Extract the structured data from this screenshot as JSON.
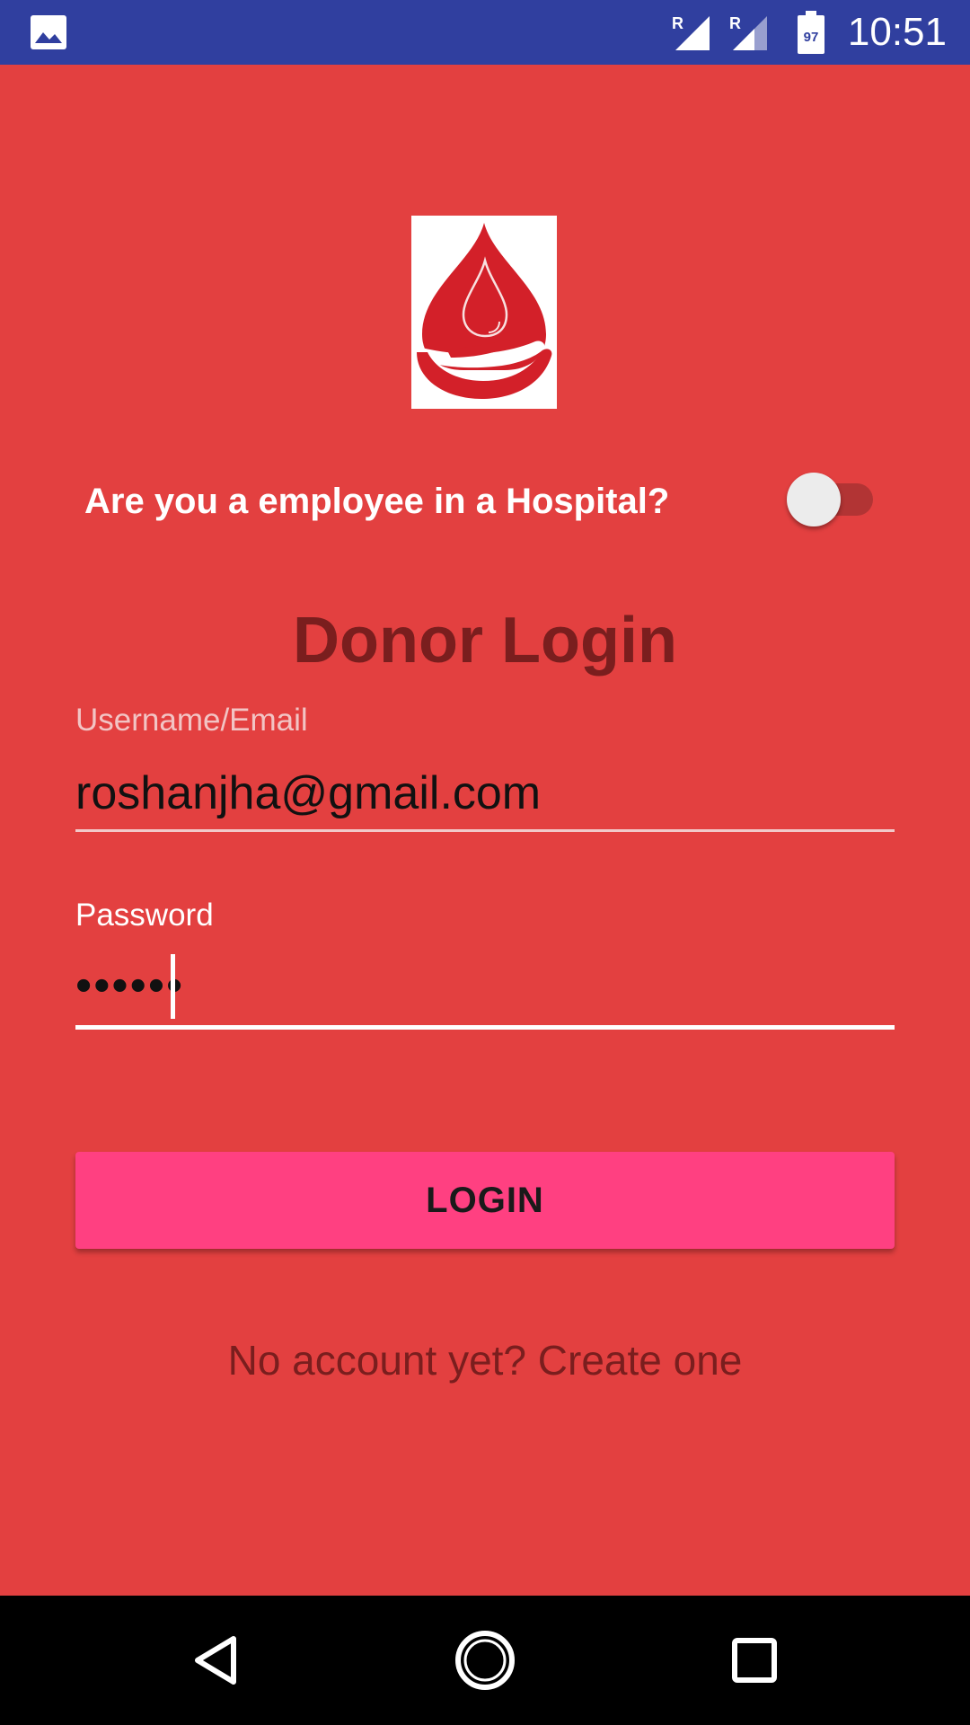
{
  "status_bar": {
    "time": "10:51",
    "battery_level": "97",
    "signal_labels": [
      "R",
      "R"
    ],
    "icons": [
      "image-icon",
      "signal-icon",
      "signal-icon",
      "battery-icon"
    ]
  },
  "logo": {
    "icon": "blood-drop-hand-icon"
  },
  "hospital_toggle": {
    "question": "Are you a employee in a Hospital?",
    "checked": false
  },
  "login": {
    "title": "Donor Login",
    "username_label": "Username/Email",
    "username_value": "roshanjha@gmail.com",
    "password_label": "Password",
    "password_value": "••••••",
    "button_label": "LOGIN",
    "create_account_link": "No account yet? Create one"
  },
  "nav_bar": {
    "icons": [
      "back-icon",
      "home-icon",
      "recent-apps-icon"
    ]
  },
  "colors": {
    "background": "#E34040",
    "status_bar": "#303F9F",
    "accent_button": "#FF4081",
    "title_text": "#7A1E1E",
    "nav_bar": "#000000"
  }
}
